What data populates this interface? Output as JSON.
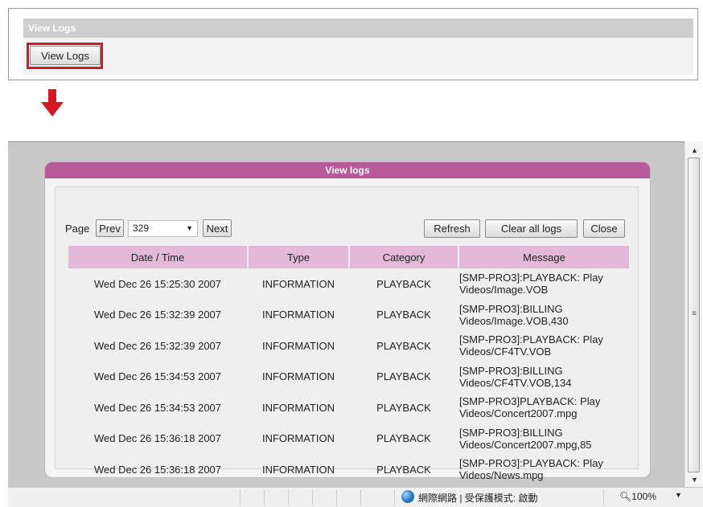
{
  "top_panel": {
    "header": "View Logs",
    "button": "View Logs"
  },
  "dialog": {
    "title": "View logs",
    "page_label": "Page",
    "prev": "Prev",
    "page_value": "329",
    "next": "Next",
    "refresh": "Refresh",
    "clear_all": "Clear all logs",
    "close": "Close",
    "columns": [
      "Date / Time",
      "Type",
      "Category",
      "Message"
    ],
    "rows": [
      {
        "datetime": "Wed Dec 26 15:25:30 2007",
        "type": "INFORMATION",
        "category": "PLAYBACK",
        "message_line1": "[SMP-PRO3]:PLAYBACK: Play",
        "message_line2": "Videos/Image.VOB"
      },
      {
        "datetime": "Wed Dec 26 15:32:39 2007",
        "type": "INFORMATION",
        "category": "PLAYBACK",
        "message_line1": "[SMP-PRO3]:BILLING",
        "message_line2": "Videos/Image.VOB,430"
      },
      {
        "datetime": "Wed Dec 26 15:32:39 2007",
        "type": "INFORMATION",
        "category": "PLAYBACK",
        "message_line1": "[SMP-PRO3]:PLAYBACK: Play",
        "message_line2": "Videos/CF4TV.VOB"
      },
      {
        "datetime": "Wed Dec 26 15:34:53 2007",
        "type": "INFORMATION",
        "category": "PLAYBACK",
        "message_line1": "[SMP-PRO3]:BILLING",
        "message_line2": "Videos/CF4TV.VOB,134"
      },
      {
        "datetime": "Wed Dec 26 15:34:53 2007",
        "type": "INFORMATION",
        "category": "PLAYBACK",
        "message_line1": "[SMP-PRO3]PLAYBACK: Play",
        "message_line2": "Videos/Concert2007.mpg"
      },
      {
        "datetime": "Wed Dec 26 15:36:18 2007",
        "type": "INFORMATION",
        "category": "PLAYBACK",
        "message_line1": "[SMP-PRO3]:BILLING",
        "message_line2": "Videos/Concert2007.mpg,85"
      },
      {
        "datetime": "Wed Dec 26 15:36:18 2007",
        "type": "INFORMATION",
        "category": "PLAYBACK",
        "message_line1": "[SMP-PRO3]:PLAYBACK: Play",
        "message_line2": "Videos/News.mpg"
      }
    ]
  },
  "statusbar": {
    "zone": "網際網路 | 受保護模式: 啟動",
    "zoom": "100%"
  },
  "icons": {
    "arrow": "down-arrow-icon",
    "globe": "globe-icon",
    "zoom": "magnifier-icon"
  },
  "colors": {
    "highlight": "#d31a24",
    "dialog_title": "#b8599a",
    "table_header": "#e4b8d8",
    "arrow": "#d31a24"
  }
}
